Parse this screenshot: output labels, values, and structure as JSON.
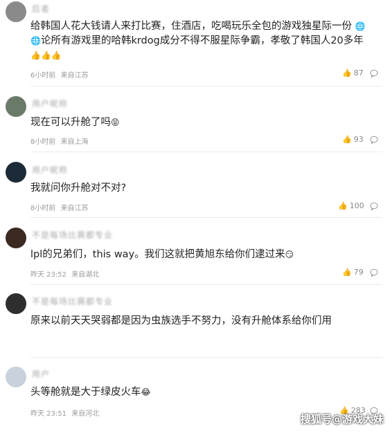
{
  "comments": [
    {
      "username": "后者",
      "text": "给韩国人花大钱请人来打比赛，住酒店，吃喝玩乐全包的游戏独星际一份",
      "text2": "论所有游戏里的哈韩krdog成分不得不服星际争霸，孝敬了韩国人20多年",
      "emoji_trail": "👍👍👍",
      "time": "6小时前",
      "location": "来自江苏",
      "likes": "87"
    },
    {
      "username": "用户昵称",
      "text": "现在可以升舱了吗",
      "time": "8小时前",
      "location": "来自上海",
      "likes": "93"
    },
    {
      "username": "用户昵称",
      "text": "我就问你升舱对不对?",
      "time": "8小时前",
      "location": "来自江苏",
      "likes": "100"
    },
    {
      "username": "不是每场比赛都专业",
      "text": "lpl的兄弟们，this way。我们这就把黄旭东给你们逮过来",
      "time": "昨天 23:52",
      "location": "来自湖北",
      "likes": "79"
    },
    {
      "username": "不是每场比赛都专业",
      "text": "原来以前天天哭弱都是因为虫族选手不努力，没有升舱体系给你们用",
      "time": "",
      "location": "",
      "likes": ""
    },
    {
      "username": "用户",
      "text": "头等舱就是大于绿皮火车",
      "time": "昨天 23:51",
      "location": "来自河北",
      "likes": "283"
    }
  ],
  "watermark": "搜狐号@游戏大妹"
}
